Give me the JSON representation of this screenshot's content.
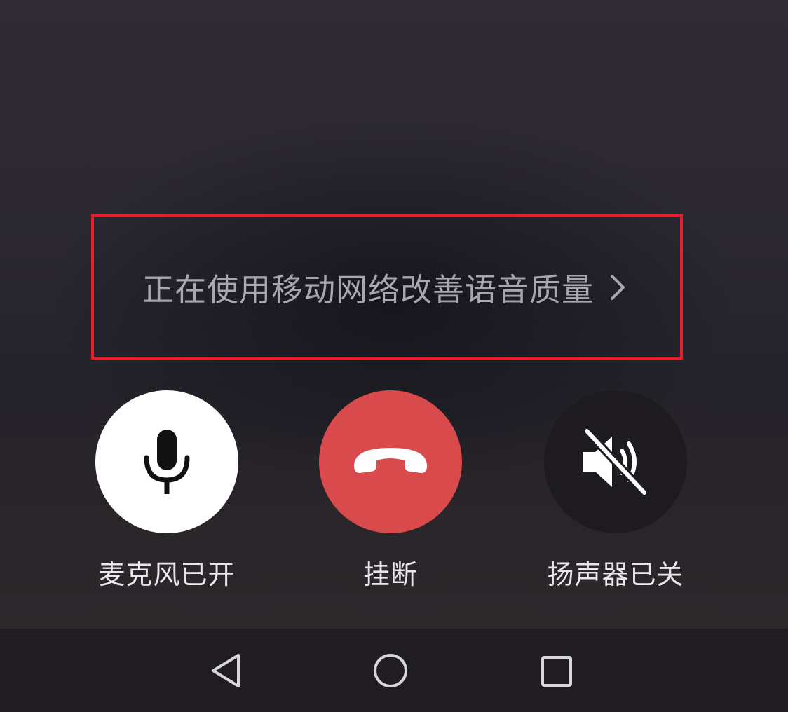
{
  "notice": {
    "text": "正在使用移动网络改善语音质量",
    "icon": "chevron-right-icon",
    "highlight_color": "#e4202a"
  },
  "controls": {
    "microphone": {
      "label": "麦克风已开",
      "icon": "microphone-icon",
      "state": "on",
      "color": "#ffffff"
    },
    "hangup": {
      "label": "挂断",
      "icon": "phone-hangup-icon",
      "color": "#d94a4d"
    },
    "speaker": {
      "label": "扬声器已关",
      "icon": "speaker-muted-icon",
      "state": "off",
      "color": "#1d1b20"
    }
  },
  "navbar": {
    "back": {
      "icon": "back-triangle-icon"
    },
    "home": {
      "icon": "home-circle-icon"
    },
    "recents": {
      "icon": "recents-square-icon"
    }
  }
}
